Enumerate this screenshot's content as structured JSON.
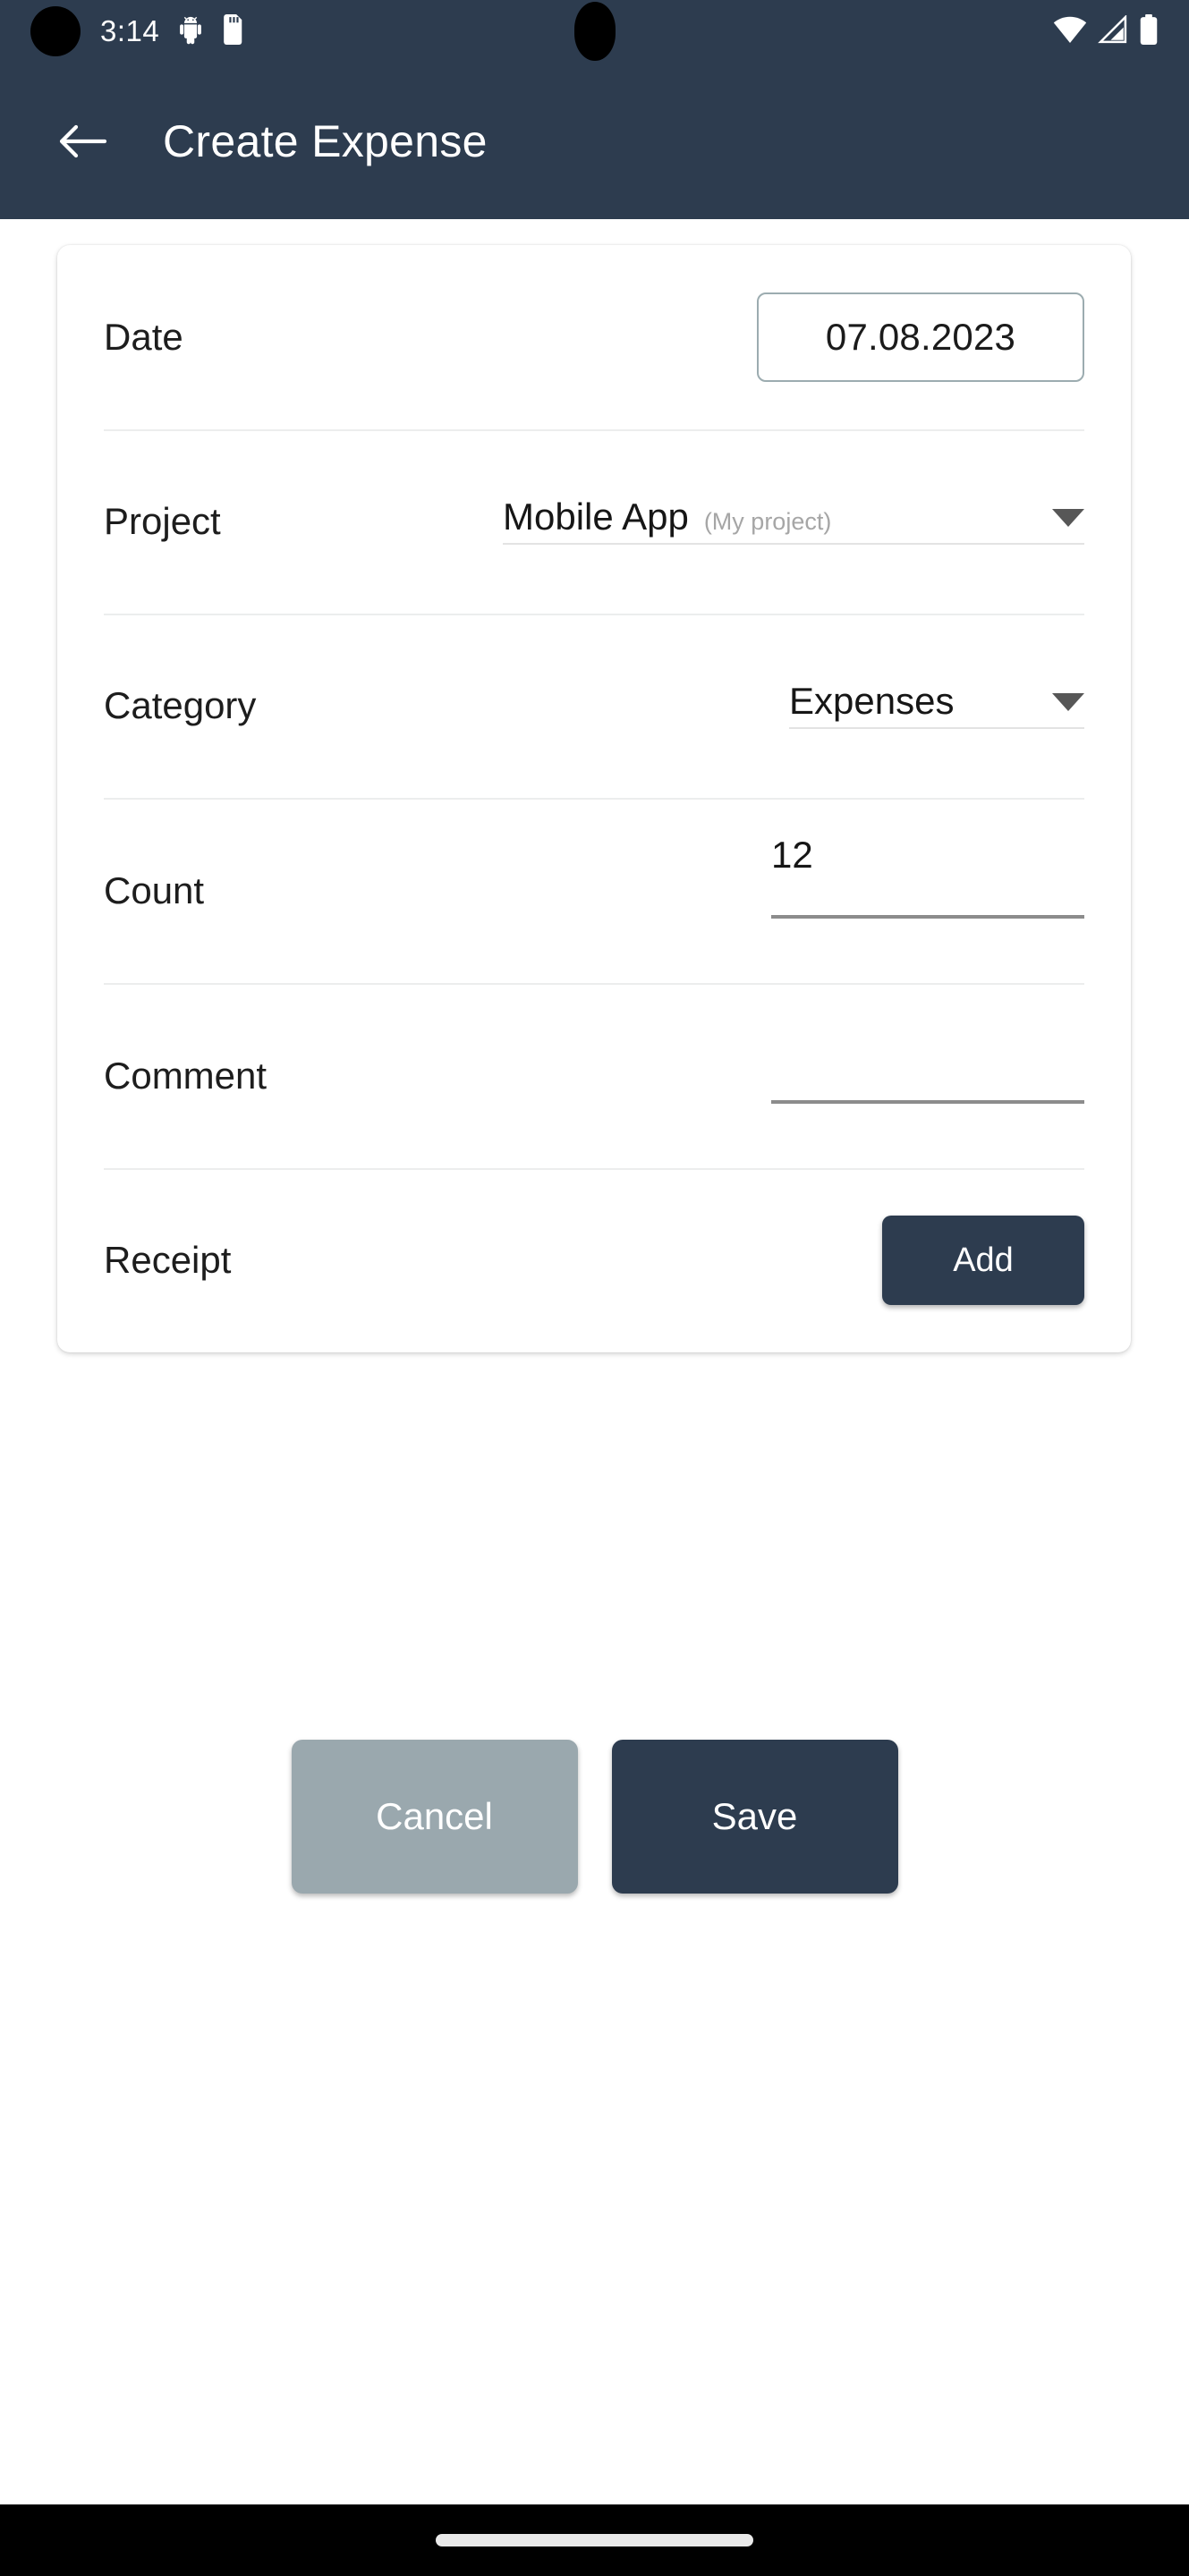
{
  "status_bar": {
    "time": "3:14",
    "left_icons": [
      "camera-punch-hole",
      "android-debug-icon",
      "sd-card-icon"
    ],
    "right_icons": [
      "wifi-icon",
      "cell-signal-icon",
      "battery-icon"
    ],
    "background_color": "#2d3c4f"
  },
  "app_bar": {
    "back_icon": "arrow-left-icon",
    "title": "Create Expense",
    "background_color": "#2d3c4f",
    "text_color": "#ffffff"
  },
  "form": {
    "rows": [
      {
        "label": "Date",
        "type": "date-box",
        "value": "07.08.2023"
      },
      {
        "label": "Project",
        "type": "dropdown",
        "value": "Mobile App",
        "hint": "(My project)",
        "caret_icon": "chevron-down-icon"
      },
      {
        "label": "Category",
        "type": "dropdown",
        "value": "Expenses",
        "hint": "",
        "caret_icon": "chevron-down-icon"
      },
      {
        "label": "Count",
        "type": "text-input",
        "value": "12",
        "placeholder": ""
      },
      {
        "label": "Comment",
        "type": "text-input",
        "value": "",
        "placeholder": ""
      },
      {
        "label": "Receipt",
        "type": "button",
        "button_label": "Add"
      }
    ]
  },
  "actions": {
    "cancel_label": "Cancel",
    "save_label": "Save",
    "cancel_color": "#9aa8ae",
    "save_color": "#2d3c4f"
  },
  "nav_bar": {
    "background_color": "#000000",
    "gesture_pill_color": "#e9e9e9"
  }
}
